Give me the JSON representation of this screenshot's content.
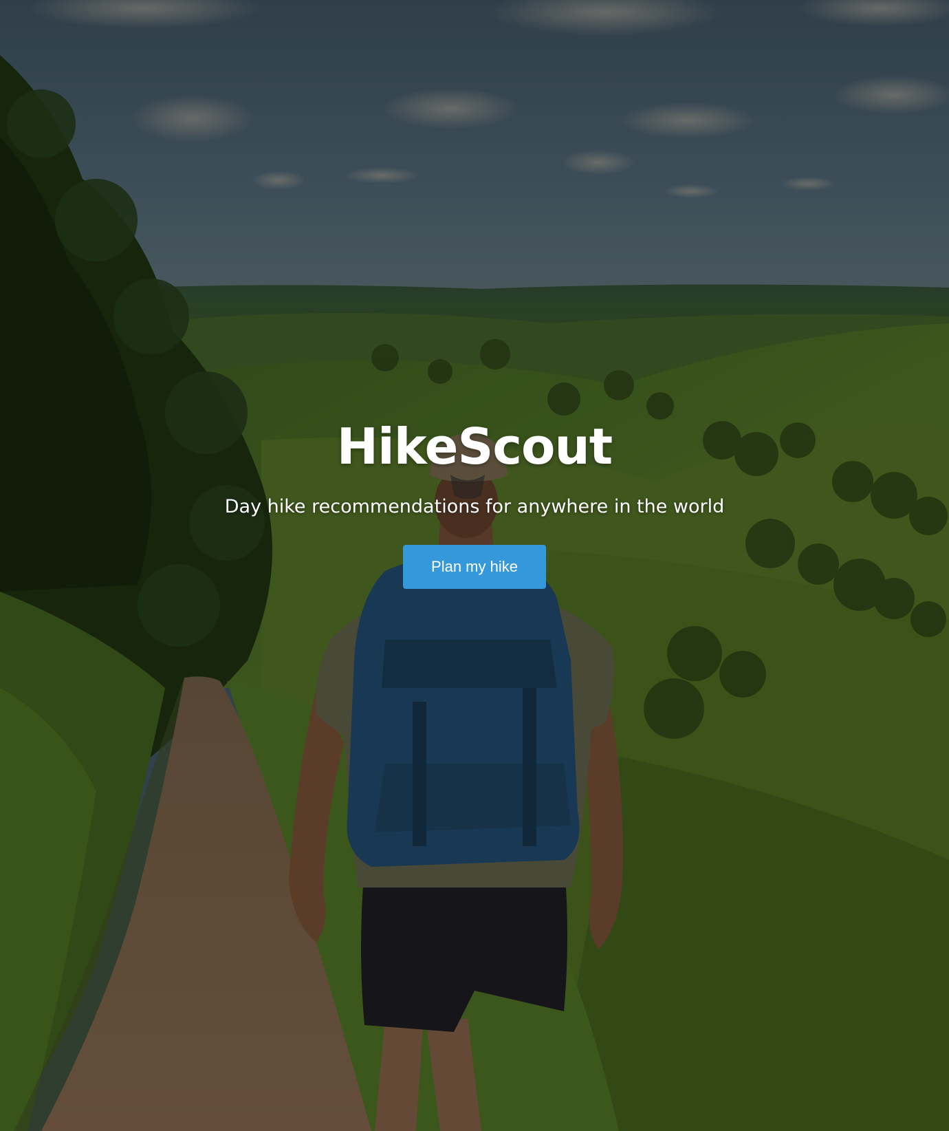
{
  "hero": {
    "title": "HikeScout",
    "subtitle": "Day hike recommendations for anywhere in the world",
    "cta_label": "Plan my hike",
    "background_image": "hiker-on-trail-overlooking-green-valley"
  },
  "colors": {
    "cta_background": "#3498db",
    "text": "#ffffff",
    "sky": "#3f5564",
    "hills": "#3f5a23"
  }
}
